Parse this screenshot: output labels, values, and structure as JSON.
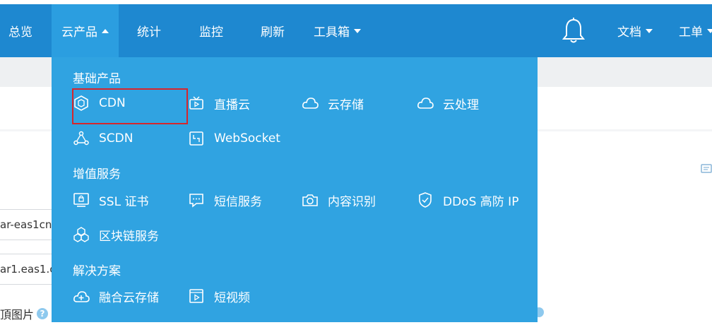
{
  "navbar": {
    "items": [
      {
        "label": "总览"
      },
      {
        "label": "云产品"
      },
      {
        "label": "统计"
      },
      {
        "label": "监控"
      },
      {
        "label": "刷新"
      },
      {
        "label": "工具箱"
      }
    ],
    "right": [
      {
        "label": "文档"
      },
      {
        "label": "工单"
      }
    ]
  },
  "dropdown": {
    "sections": [
      {
        "title": "基础产品",
        "items": [
          "CDN",
          "直播云",
          "云存储",
          "云处理",
          "SCDN",
          "WebSocket"
        ]
      },
      {
        "title": "增值服务",
        "items": [
          "SSL 证书",
          "短信服务",
          "内容识别",
          "DDoS 高防 IP",
          "区块链服务"
        ]
      },
      {
        "title": "解决方案",
        "items": [
          "融合云存储",
          "短视频"
        ]
      }
    ]
  },
  "background": {
    "input1": "ar-eas1cn",
    "input2": "ar1.eas1.c",
    "label": "頂图片",
    "help": "?"
  },
  "colors": {
    "navbar": "#1e88d0",
    "dropdown": "#30a3e1",
    "highlight": "#d6262c"
  }
}
